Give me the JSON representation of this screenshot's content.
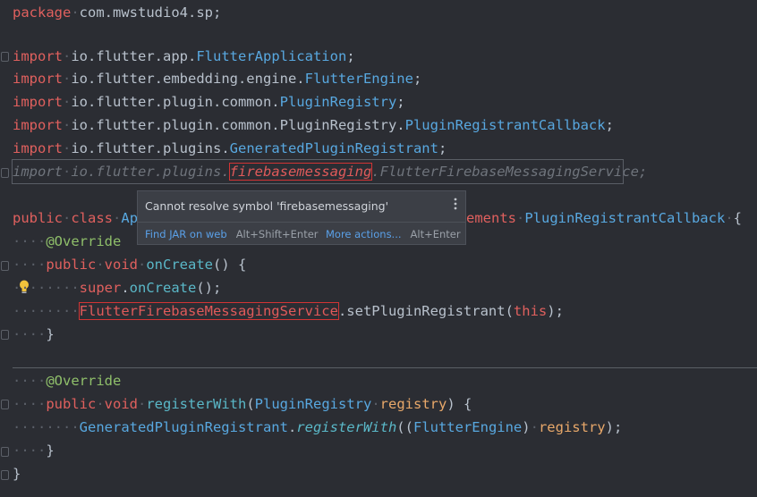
{
  "code": {
    "line1": {
      "kw": "package",
      "pkg": "com.mwstudio4.sp",
      "semi": ";"
    },
    "imports": [
      {
        "kw": "import",
        "pkg": "io.flutter.app.",
        "cls": "FlutterApplication",
        "semi": ";"
      },
      {
        "kw": "import",
        "pkg": "io.flutter.embedding.engine.",
        "cls": "FlutterEngine",
        "semi": ";"
      },
      {
        "kw": "import",
        "pkg": "io.flutter.plugin.common.",
        "cls": "PluginRegistry",
        "semi": ";"
      },
      {
        "kw": "import",
        "pkg": "io.flutter.plugin.common.PluginRegistry.",
        "cls": "PluginRegistrantCallback",
        "semi": ";"
      },
      {
        "kw": "import",
        "pkg": "io.flutter.plugins.",
        "cls": "GeneratedPluginRegistrant",
        "semi": ";"
      }
    ],
    "unused_import": {
      "kw": "import",
      "pkg": "io.flutter.plugins.",
      "err": "firebasemessaging",
      "rest": ".FlutterFirebaseMessagingService;"
    },
    "class_line": {
      "kw1": "public",
      "kw2": "class",
      "name_start": "App",
      "tail_kw": "ements",
      "iface": "PluginRegistrantCallback",
      "brace": "{"
    },
    "annotation": "@Override",
    "oncreate": {
      "kw1": "public",
      "kw2": "void",
      "fn": "onCreate",
      "rest": "() {"
    },
    "super_call": {
      "kw": "super",
      "dot": ".",
      "fn": "onCreate",
      "rest": "();"
    },
    "set_registrant": {
      "err": "FlutterFirebaseMessagingService",
      "mid": ".setPluginRegistrant(",
      "kw": "this",
      "end": ");"
    },
    "close_brace": "}",
    "register": {
      "kw1": "public",
      "kw2": "void",
      "fn": "registerWith",
      "open": "(",
      "cls": "PluginRegistry",
      "param": "registry",
      "end": ") {"
    },
    "gen_call": {
      "cls": "GeneratedPluginRegistrant",
      "dot": ".",
      "fn": "registerWith",
      "open": "((",
      "cast": "FlutterEngine",
      "close": ")",
      "param": "registry",
      "end": ");"
    },
    "class_close": "}"
  },
  "tooltip": {
    "message": "Cannot resolve symbol 'firebasemessaging'",
    "action1": "Find JAR on web",
    "shortcut1": "Alt+Shift+Enter",
    "action2": "More actions...",
    "shortcut2": "Alt+Enter"
  },
  "colors": {
    "background": "#2b2d33",
    "keyword": "#e0605e",
    "class": "#58a8e0",
    "error": "#d23434"
  },
  "icons": {
    "bulb": "lightbulb-icon",
    "more": "more-vertical-icon"
  }
}
